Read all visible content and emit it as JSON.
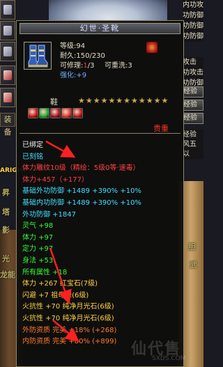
{
  "item": {
    "name": "幻世·圣靴",
    "level_line": "等级:94",
    "durability_line": "耐久:150/230",
    "repairable_label": "可修理:",
    "repairable_value": "1",
    "repairable_max": "/3",
    "refine_line": "可重洗:3",
    "enhance_label": "强化:",
    "enhance_value": "+9",
    "type": "鞋",
    "stars": "★★★★★★★★★★★★",
    "rarity": "贵重",
    "icon": "blue-armored-boots-icon",
    "badge_icon": "red-star-badge-icon"
  },
  "gems": [
    {
      "icon": "red-gem-icon",
      "color": "#c21818"
    },
    {
      "icon": "green-gem-icon",
      "color": "#1aa82a"
    },
    {
      "icon": "crimson-gem-icon",
      "color": "#a01420"
    },
    {
      "icon": "red-feather-icon",
      "color": "#d83a2a"
    },
    {
      "icon": "scarlet-gem-icon",
      "color": "#b41c1c"
    }
  ],
  "stats": [
    {
      "text": "已绑定",
      "color": "white"
    },
    {
      "text": "已刻铭",
      "color": "cyan"
    },
    {
      "text": "体力雕纹10级（精绘：5级0等·速毒）",
      "color": "red"
    },
    {
      "text": "体力+457（+177）",
      "color": "red"
    },
    {
      "text": "基础外功防御 +1489 +390% +10%",
      "color": "cyan"
    },
    {
      "text": "基础内功防御 +1489 +390% +10%",
      "color": "cyan"
    },
    {
      "text": "外功防御 +1847",
      "color": "cyan"
    },
    {
      "text": "灵气 +98",
      "color": "green"
    },
    {
      "text": "体力 +97",
      "color": "green"
    },
    {
      "text": "定力 +97",
      "color": "green"
    },
    {
      "text": "身法 +53",
      "color": "green"
    },
    {
      "text": "所有属性 +18",
      "color": "green"
    },
    {
      "text": "体力 +267 红宝石(7级)",
      "color": "yellow"
    },
    {
      "text": "闪避 +7 祖母绿(6级)",
      "color": "yellow"
    },
    {
      "text": "火抗性 +70 纯净月光石(6级)",
      "color": "yellow"
    },
    {
      "text": "火抗性 +70 纯净月光石(6级)",
      "color": "yellow"
    },
    {
      "text": "外防资质   完美 +18% (+268)",
      "color": "orange"
    },
    {
      "text": "内防资质   完美 +80% (+899)",
      "color": "orange"
    }
  ],
  "right_panel": {
    "rows": [
      "内功攻击",
      "功防御",
      "功防御",
      "功防御"
    ],
    "rows2": [
      "攻击",
      "功攻击",
      "功防御"
    ],
    "buttons": [
      "经验",
      "经验",
      "经验"
    ],
    "after": [
      "经验",
      "风五",
      "以"
    ]
  },
  "left_panel": {
    "equip_tab": "装备"
  },
  "background": {
    "ghost_texts": [
      "昇",
      "ARIGHT",
      "塔",
      "影",
      "光",
      "龙能",
      "胆",
      "武"
    ]
  },
  "watermark": "仙代售",
  "watermark_sub": "SXDS.COM"
}
